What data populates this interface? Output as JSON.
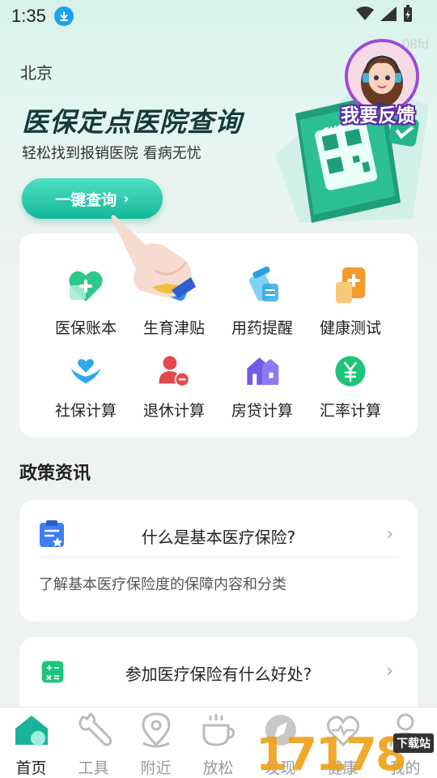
{
  "status": {
    "time": "1:35"
  },
  "hero": {
    "id_text": "ID：08fd",
    "city": "北京",
    "title": "医保定点医院查询",
    "subtitle": "轻松找到报销医院 看病无忧",
    "button_label": "一键查询",
    "button_chevron": "›",
    "feedback_label": "我要反馈"
  },
  "grid": {
    "items": [
      {
        "label": "医保账本",
        "icon": "heart-plus-icon"
      },
      {
        "label": "生育津贴",
        "icon": "baby-bottle-icon"
      },
      {
        "label": "用药提醒",
        "icon": "pill-bottle-icon"
      },
      {
        "label": "健康测试",
        "icon": "medical-kit-icon"
      },
      {
        "label": "社保计算",
        "icon": "hands-heart-icon"
      },
      {
        "label": "退休计算",
        "icon": "person-minus-icon"
      },
      {
        "label": "房贷计算",
        "icon": "house-icon"
      },
      {
        "label": "汇率计算",
        "icon": "yen-exchange-icon"
      }
    ]
  },
  "section": {
    "title": "政策资讯"
  },
  "news": [
    {
      "title": "什么是基本医疗保险?",
      "desc": "了解基本医疗保险度的保障内容和分类",
      "chevron": "›"
    },
    {
      "title": "参加医疗保险有什么好处?",
      "chevron": "›"
    }
  ],
  "nav": {
    "items": [
      {
        "label": "首页",
        "active": true
      },
      {
        "label": "工具"
      },
      {
        "label": "附近"
      },
      {
        "label": "放松"
      },
      {
        "label": "发现"
      },
      {
        "label": "健康"
      },
      {
        "label": "我的"
      }
    ]
  },
  "watermark": {
    "number": "17178",
    "tag": "下载站"
  },
  "colors": {
    "accent": "#14b79a",
    "feedback_outline": "#5a2ea6",
    "title": "#173a3a"
  }
}
